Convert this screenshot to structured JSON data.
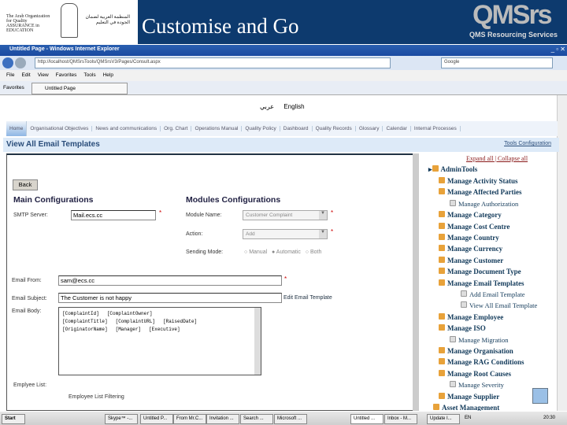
{
  "header": {
    "org_en": "The Arab Organization for Quality ASSURANCE in EDUCATION",
    "org_ar": "المنظمة العربية لضمان الجودة في التعليم",
    "title": "Customise and Go",
    "brand": "QMSrs",
    "brand_sub": "QMS Resourcing Services"
  },
  "browser": {
    "title": "Untitled Page - Windows Internet Explorer",
    "url": "http://localhost/QMSrsTools/QMSrsV3/Pages/Consult.aspx",
    "search_placeholder": "Google",
    "menu": [
      "File",
      "Edit",
      "View",
      "Favorites",
      "Tools",
      "Help"
    ],
    "favorites": "Favorites",
    "tab": "Untitled Page"
  },
  "lang": {
    "arabic": "عربي",
    "english": "English"
  },
  "nav": [
    "Home",
    "Organisational Objectives",
    "News and communications",
    "Org. Chart",
    "Operations Manual",
    "Quality Policy",
    "Dashboard",
    "Quality Records",
    "Glossary",
    "Calendar",
    "Internal Processes"
  ],
  "section": {
    "title": "View All Email Templates",
    "tools_link": "Tools Configuration"
  },
  "form": {
    "back": "Back",
    "main_heading": "Main Configurations",
    "modules_heading": "Modules Configurations",
    "smtp_label": "SMTP Server:",
    "smtp_value": "Mail.ecs.cc",
    "module_label": "Module Name:",
    "module_value": "Customer Complaint",
    "action_label": "Action:",
    "action_value": "Add",
    "sending_label": "Sending Mode:",
    "modes": [
      "Manual",
      "Automatic",
      "Both"
    ],
    "selected_mode": "Automatic",
    "from_label": "Email From:",
    "from_value": "sam@ecs.cc",
    "subject_label": "Email Subject:",
    "subject_value": "The Customer is not happy",
    "edit_link": "Edit Email Template",
    "body_label": "Email Body:",
    "body_tokens": [
      [
        "[ComplaintId]",
        "[ComplaintOwner]"
      ],
      [
        "[ComplaintTitle]",
        "[ComplaintURL]",
        "[RaisedDate]"
      ],
      [
        "[OriginatorName]",
        "[Manager]",
        "[Executive]"
      ]
    ],
    "employee_list": "Emplyee List:",
    "employee_filter": "Employee List Filtering",
    "required": "*"
  },
  "tree": {
    "expand": "Expand all",
    "collapse": "Collapse all",
    "root": "AdminTools",
    "items": [
      {
        "label": "Manage Activity Status",
        "level": 1
      },
      {
        "label": "Manage Affected Parties",
        "level": 1
      },
      {
        "label": "Manage Authorization",
        "level": 2
      },
      {
        "label": "Manage Category",
        "level": 1
      },
      {
        "label": "Manage Cost Centre",
        "level": 1
      },
      {
        "label": "Manage Country",
        "level": 1
      },
      {
        "label": "Manage Currency",
        "level": 1
      },
      {
        "label": "Manage Customer",
        "level": 1
      },
      {
        "label": "Manage Document Type",
        "level": 1
      },
      {
        "label": "Manage Email Templates",
        "level": 1
      },
      {
        "label": "Add Email Template",
        "level": 3
      },
      {
        "label": "View All Email Template",
        "level": 3
      },
      {
        "label": "Manage Employee",
        "level": 1
      },
      {
        "label": "Manage ISO",
        "level": 1
      },
      {
        "label": "Manage Migration",
        "level": 2
      },
      {
        "label": "Manage Organisation",
        "level": 1
      },
      {
        "label": "Manage RAG Conditions",
        "level": 1
      },
      {
        "label": "Manage Root Causes",
        "level": 1
      },
      {
        "label": "Manage Severity",
        "level": 2
      },
      {
        "label": "Manage Supplier",
        "level": 1
      }
    ],
    "last": "Asset Management"
  },
  "taskbar": {
    "start": "Start",
    "tasks": [
      "Skype™ -...",
      "Untitled P...",
      "From Mr.C...",
      "Invitation ...",
      "Search ...",
      "Microsoft ...",
      "Untitled ...",
      "Inbox - M...",
      "Update I..."
    ],
    "lang": "EN",
    "clock": "20:30"
  }
}
